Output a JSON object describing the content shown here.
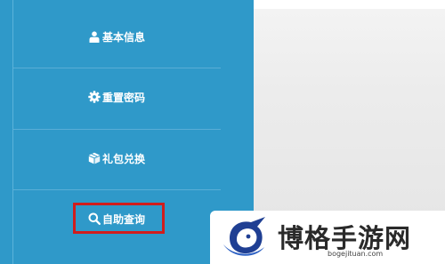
{
  "menu": {
    "items": [
      {
        "label": "基本信息",
        "icon": "user-icon"
      },
      {
        "label": "重置密码",
        "icon": "gear-icon"
      },
      {
        "label": "礼包兑换",
        "icon": "gift-box-icon"
      },
      {
        "label": "自助查询",
        "icon": "search-icon"
      }
    ],
    "highlighted_item": "自助查询"
  },
  "colors": {
    "menu_background": "#2f99c9",
    "highlight_border": "#d11c1c",
    "content_background": "#ececec"
  },
  "watermark": {
    "title": "博格手游网",
    "url": "bogejituan.com"
  }
}
